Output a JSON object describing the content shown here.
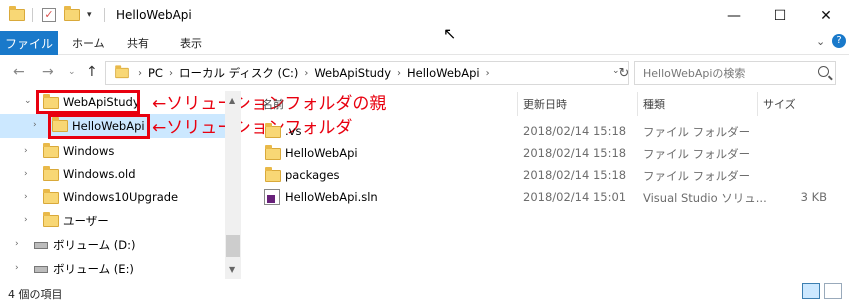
{
  "window": {
    "title": "HelloWebApi"
  },
  "ribbon": {
    "file": "ファイル",
    "home": "ホーム",
    "share": "共有",
    "view": "表示"
  },
  "address": {
    "segments": [
      "PC",
      "ローカル ディスク (C:)",
      "WebApiStudy",
      "HelloWebApi"
    ]
  },
  "search": {
    "placeholder": "HelloWebApiの検索"
  },
  "nav": {
    "items": [
      {
        "label": "WebApiStudy"
      },
      {
        "label": "HelloWebApi"
      },
      {
        "label": "Windows"
      },
      {
        "label": "Windows.old"
      },
      {
        "label": "Windows10Upgrade"
      },
      {
        "label": "ユーザー"
      },
      {
        "label": "ボリューム (D:)"
      },
      {
        "label": "ボリューム (E:)"
      }
    ]
  },
  "annotations": {
    "parent": "←ソリューションフォルダの親",
    "solution": "←ソリューションフォルダ"
  },
  "columns": {
    "name": "名前",
    "date": "更新日時",
    "type": "種類",
    "size": "サイズ"
  },
  "files": [
    {
      "name": ".vs",
      "date": "2018/02/14 15:18",
      "type": "ファイル フォルダー",
      "size": "",
      "icon": "folder-icon"
    },
    {
      "name": "HelloWebApi",
      "date": "2018/02/14 15:18",
      "type": "ファイル フォルダー",
      "size": "",
      "icon": "folder-icon"
    },
    {
      "name": "packages",
      "date": "2018/02/14 15:18",
      "type": "ファイル フォルダー",
      "size": "",
      "icon": "folder-icon"
    },
    {
      "name": "HelloWebApi.sln",
      "date": "2018/02/14 15:01",
      "type": "Visual Studio ソリュ...",
      "size": "3 KB",
      "icon": "visual-studio-solution-icon"
    }
  ],
  "status": {
    "count": "4 個の項目"
  },
  "colors": {
    "accent": "#1979ca",
    "selection": "#cce8ff",
    "annotation": "#e8000f"
  }
}
